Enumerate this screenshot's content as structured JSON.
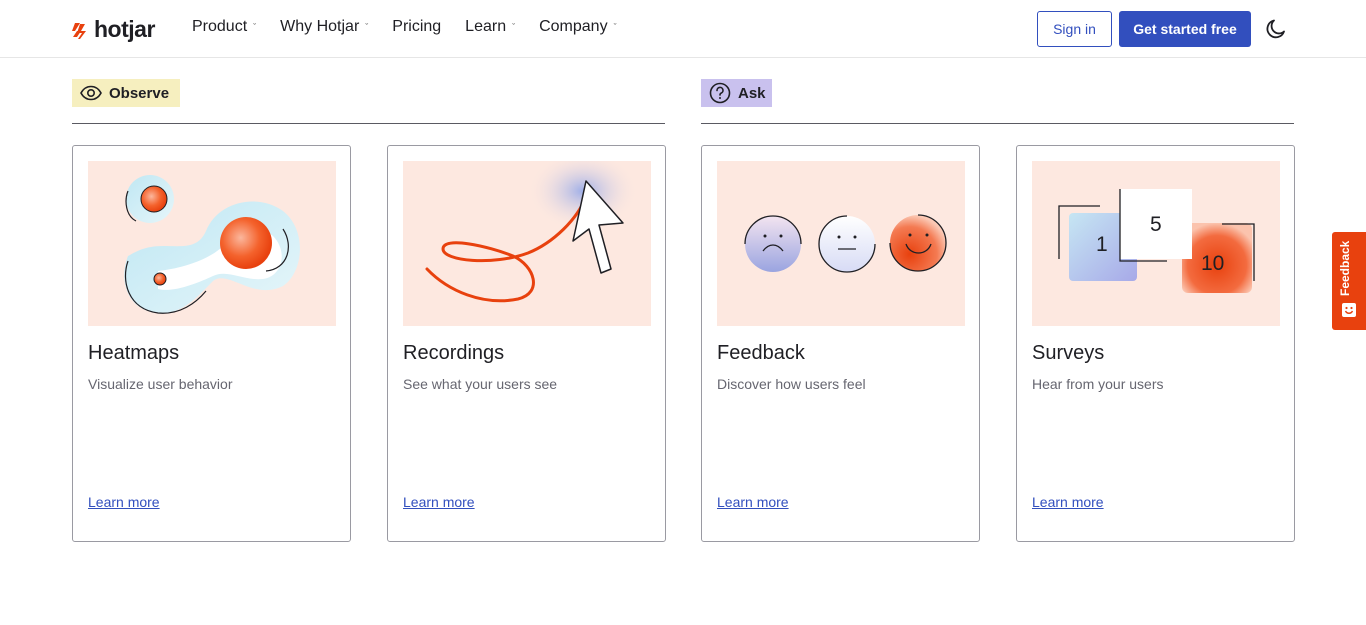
{
  "header": {
    "logo_text": "hotjar",
    "nav": [
      {
        "label": "Product",
        "has_dropdown": true
      },
      {
        "label": "Why Hotjar",
        "has_dropdown": true
      },
      {
        "label": "Pricing",
        "has_dropdown": false
      },
      {
        "label": "Learn",
        "has_dropdown": true
      },
      {
        "label": "Company",
        "has_dropdown": true
      }
    ],
    "signin_label": "Sign in",
    "cta_label": "Get started free",
    "theme_toggle_icon": "moon-icon"
  },
  "sections": {
    "observe": {
      "label": "Observe",
      "icon": "eye-icon",
      "color": "#f6efbf"
    },
    "ask": {
      "label": "Ask",
      "icon": "question-circle-icon",
      "color": "#c9c1ee"
    }
  },
  "cards": [
    {
      "title": "Heatmaps",
      "desc": "Visualize user behavior",
      "link": "Learn more"
    },
    {
      "title": "Recordings",
      "desc": "See what your users see",
      "link": "Learn more"
    },
    {
      "title": "Feedback",
      "desc": "Discover how users feel",
      "link": "Learn more"
    },
    {
      "title": "Surveys",
      "desc": "Hear from your users",
      "link": "Learn more",
      "numbers": [
        "1",
        "5",
        "10"
      ]
    }
  ],
  "feedback_tab": {
    "label": "Feedback"
  },
  "colors": {
    "brand_blue": "#324fbe",
    "brand_orange": "#e8410e",
    "illustration_bg": "#fde8e0"
  }
}
